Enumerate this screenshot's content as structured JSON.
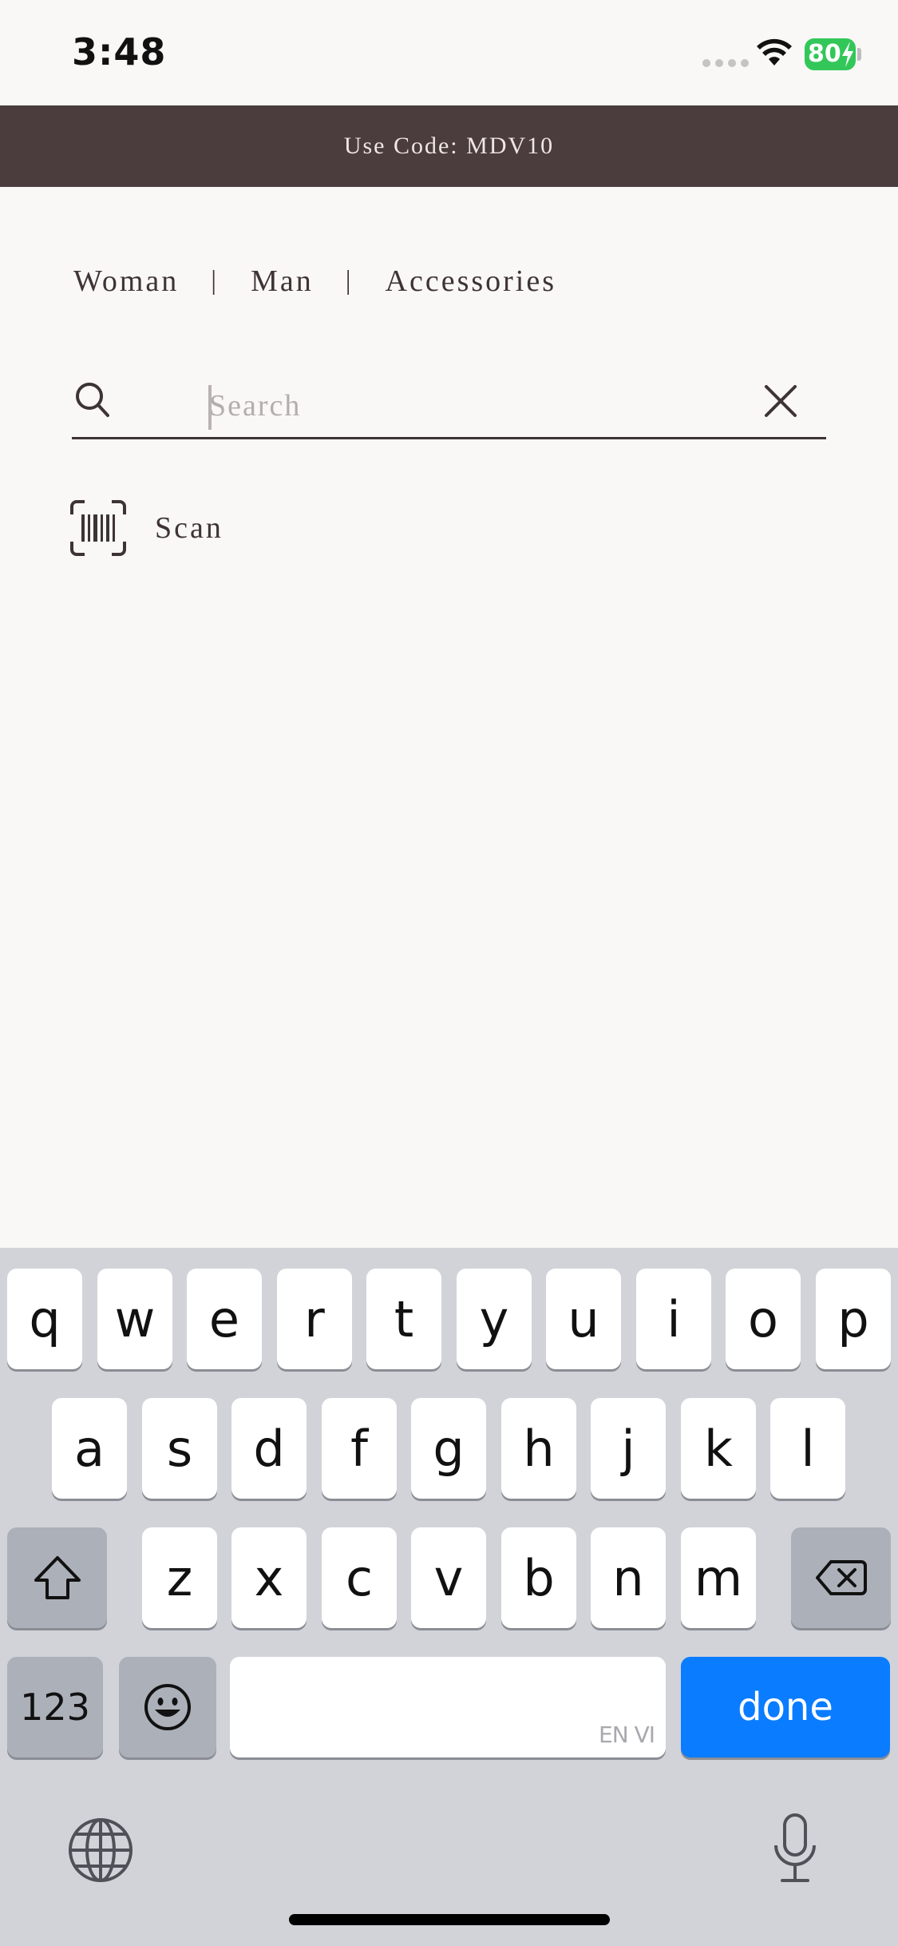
{
  "status_bar": {
    "time": "3:48",
    "battery": "80"
  },
  "promo": {
    "text": "Use Code: MDV10"
  },
  "categories": [
    {
      "label": "Woman"
    },
    {
      "label": "Man"
    },
    {
      "label": "Accessories"
    }
  ],
  "category_separator": "|",
  "search": {
    "value": "",
    "placeholder": "Search"
  },
  "scan": {
    "label": "Scan"
  },
  "keyboard": {
    "row1": [
      "q",
      "w",
      "e",
      "r",
      "t",
      "y",
      "u",
      "i",
      "o",
      "p"
    ],
    "row2": [
      "a",
      "s",
      "d",
      "f",
      "g",
      "h",
      "j",
      "k",
      "l"
    ],
    "row3": [
      "z",
      "x",
      "c",
      "v",
      "b",
      "n",
      "m"
    ],
    "numbers_label": "123",
    "space_hint": "EN VI",
    "done_label": "done"
  },
  "colors": {
    "promo_bg": "#4b3d3d",
    "text": "#3e3434",
    "done_key": "#0a7cff",
    "battery": "#33c759"
  },
  "icons": [
    "wifi-icon",
    "battery-icon",
    "search-icon",
    "close-icon",
    "barcode-scan-icon",
    "shift-icon",
    "backspace-icon",
    "emoji-icon",
    "globe-icon",
    "microphone-icon"
  ]
}
